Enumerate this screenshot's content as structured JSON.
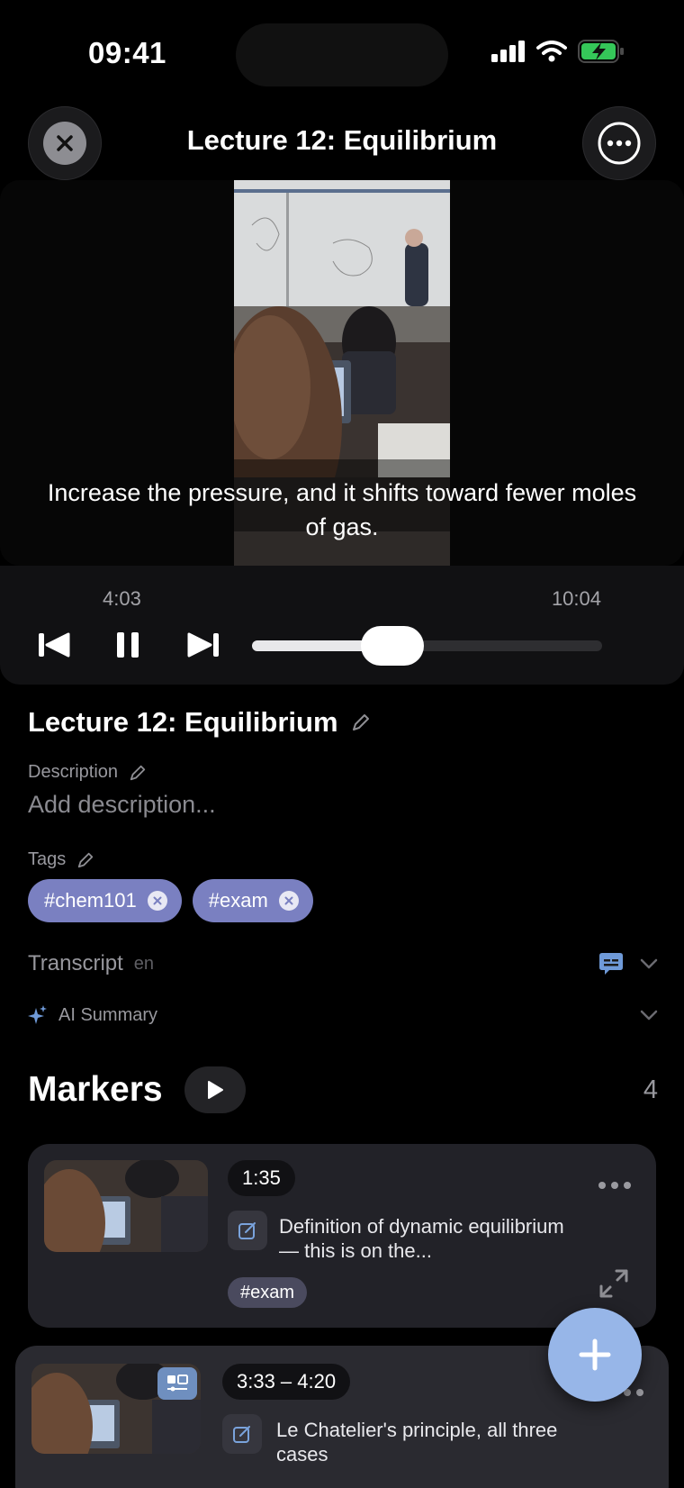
{
  "status_bar": {
    "time": "09:41"
  },
  "header": {
    "title": "Lecture 12: Equilibrium"
  },
  "player": {
    "caption": "Increase the pressure, and it shifts toward fewer moles of gas.",
    "current_time": "4:03",
    "total_time": "10:04",
    "progress": 0.4
  },
  "details": {
    "title": "Lecture 12: Equilibrium",
    "description_label": "Description",
    "description_placeholder": "Add description...",
    "tags_label": "Tags",
    "tags": [
      "#chem101",
      "#exam"
    ],
    "transcript_label": "Transcript",
    "transcript_lang": "en",
    "ai_summary_label": "AI Summary"
  },
  "markers": {
    "title": "Markers",
    "count": "4",
    "items": [
      {
        "time": "1:35",
        "note": "Definition of dynamic equilibrium — this is on the...",
        "tag": "#exam"
      },
      {
        "time": "3:33 – 4:20",
        "note": "Le Chatelier's principle, all three cases"
      }
    ]
  },
  "colors": {
    "accent": "#97b6e8",
    "tag": "#7a80c1",
    "card": "#222228"
  }
}
